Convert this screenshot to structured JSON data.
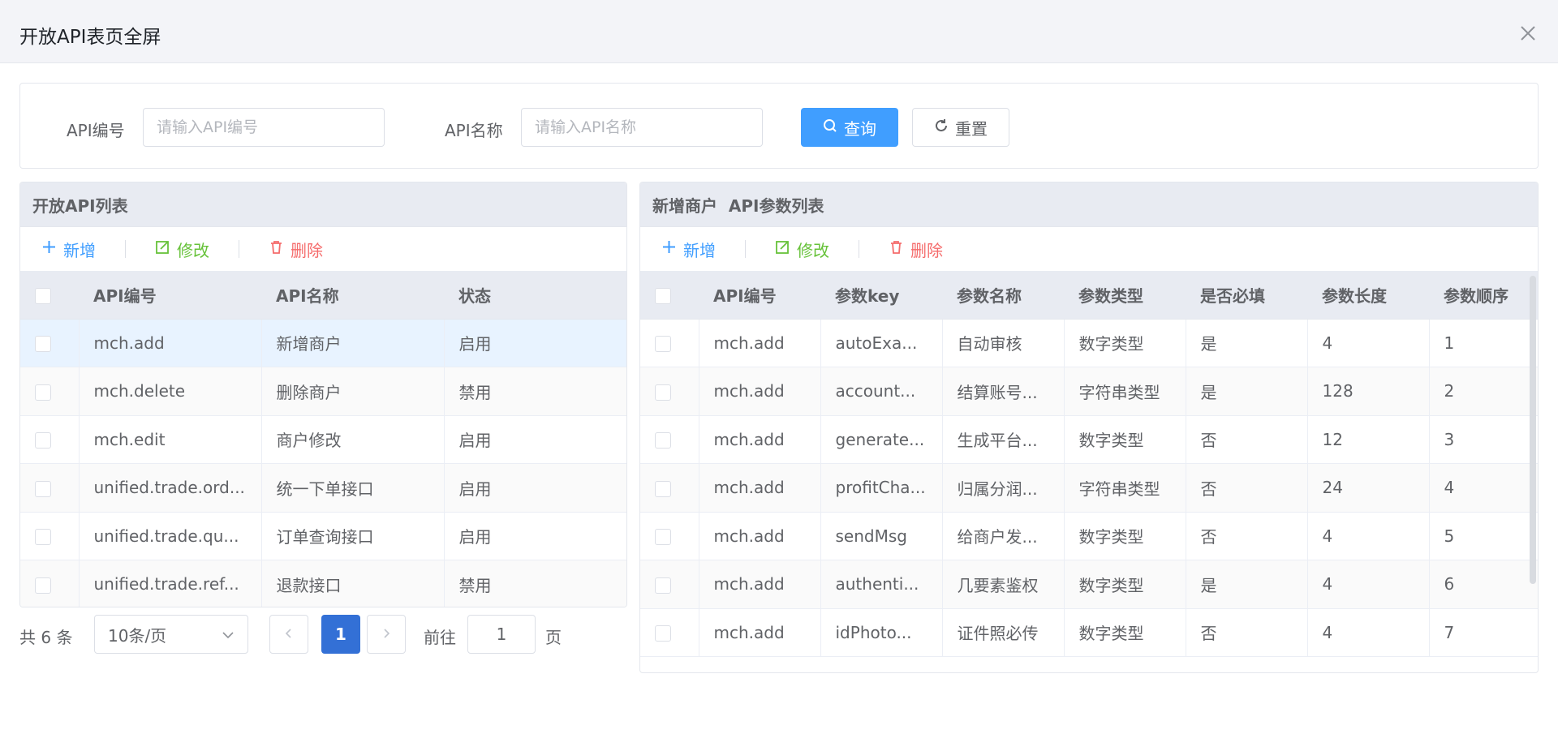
{
  "dialog": {
    "title": "开放API表页全屏"
  },
  "search": {
    "api_code_label": "API编号",
    "api_code_placeholder": "请输入API编号",
    "api_name_label": "API名称",
    "api_name_placeholder": "请输入API名称",
    "query_label": "查询",
    "reset_label": "重置"
  },
  "left_panel": {
    "title": "开放API列表",
    "toolbar": {
      "add": "新增",
      "edit": "修改",
      "delete": "删除"
    },
    "columns": [
      "API编号",
      "API名称",
      "状态"
    ],
    "rows": [
      [
        "mch.add",
        "新增商户",
        "启用"
      ],
      [
        "mch.delete",
        "删除商户",
        "禁用"
      ],
      [
        "mch.edit",
        "商户修改",
        "启用"
      ],
      [
        "unified.trade.ord...",
        "统一下单接口",
        "启用"
      ],
      [
        "unified.trade.qu...",
        "订单查询接口",
        "启用"
      ],
      [
        "unified.trade.ref...",
        "退款接口",
        "禁用"
      ]
    ],
    "selected_row": 0,
    "pagination": {
      "total": "共 6 条",
      "page_size": "10条/页",
      "current_page": "1",
      "goto_label": "前往",
      "goto_value": "1",
      "page_label": "页"
    }
  },
  "right_panel": {
    "title": "新增商户  API参数列表",
    "toolbar": {
      "add": "新增",
      "edit": "修改",
      "delete": "删除"
    },
    "columns": [
      "API编号",
      "参数key",
      "参数名称",
      "参数类型",
      "是否必填",
      "参数长度",
      "参数顺序"
    ],
    "rows": [
      [
        "mch.add",
        "autoExa...",
        "自动审核",
        "数字类型",
        "是",
        "4",
        "1"
      ],
      [
        "mch.add",
        "account...",
        "结算账号...",
        "字符串类型",
        "是",
        "128",
        "2"
      ],
      [
        "mch.add",
        "generate...",
        "生成平台...",
        "数字类型",
        "否",
        "12",
        "3"
      ],
      [
        "mch.add",
        "profitCha...",
        "归属分润...",
        "字符串类型",
        "否",
        "24",
        "4"
      ],
      [
        "mch.add",
        "sendMsg",
        "给商户发...",
        "数字类型",
        "否",
        "4",
        "5"
      ],
      [
        "mch.add",
        "authenti...",
        "几要素鉴权",
        "数字类型",
        "是",
        "4",
        "6"
      ],
      [
        "mch.add",
        "idPhoto...",
        "证件照必传",
        "数字类型",
        "否",
        "4",
        "7"
      ]
    ]
  },
  "colors": {
    "primary": "#409eff",
    "success": "#67c23a",
    "danger": "#f56c6c",
    "page_active": "#3370d6"
  }
}
